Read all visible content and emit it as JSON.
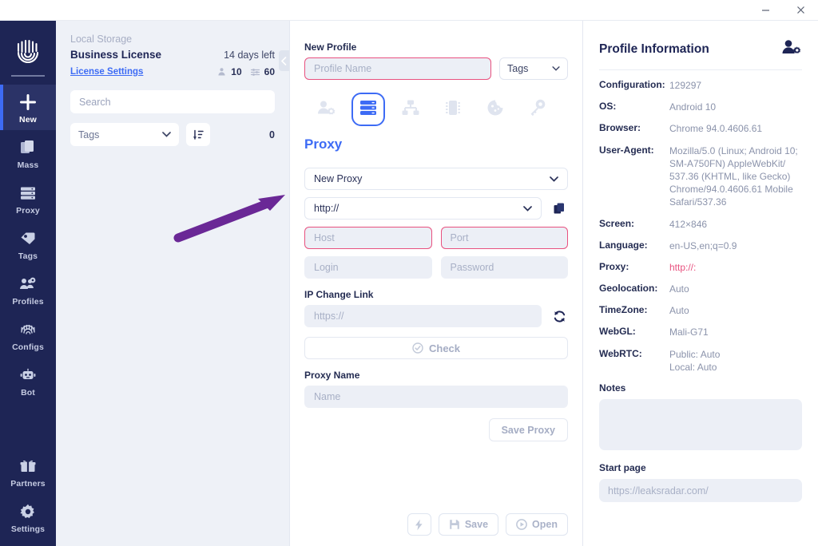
{
  "titlebar": {
    "minimize": "minimize-icon",
    "close": "close-icon"
  },
  "rail": {
    "logo": "fingerprint-logo",
    "items": [
      {
        "label": "New",
        "icon": "plus-icon",
        "active": true
      },
      {
        "label": "Mass",
        "icon": "copy-files-icon",
        "active": false
      },
      {
        "label": "Proxy",
        "icon": "server-icon",
        "active": false
      },
      {
        "label": "Tags",
        "icon": "tags-icon",
        "active": false
      },
      {
        "label": "Profiles",
        "icon": "people-gear-icon",
        "active": false
      },
      {
        "label": "Configs",
        "icon": "fingerprint-icon",
        "active": false
      },
      {
        "label": "Bot",
        "icon": "robot-icon",
        "active": false
      }
    ],
    "bottom_items": [
      {
        "label": "Partners",
        "icon": "gift-icon"
      },
      {
        "label": "Settings",
        "icon": "gear-icon"
      }
    ]
  },
  "storage": {
    "title": "Local Storage",
    "license_name": "Business License",
    "days_left": "14 days left",
    "license_settings_link": "License Settings",
    "profiles_count": "10",
    "proxies_count": "60",
    "search_placeholder": "Search",
    "tags_select": "Tags",
    "sort_icon": "sort-descending-icon",
    "total": "0",
    "collapse_icon": "chevron-left-icon"
  },
  "center": {
    "profile_label": "New Profile",
    "profile_name_placeholder": "Profile Name",
    "profile_name_value": "",
    "tags_select": "Tags",
    "tabs": [
      {
        "name": "person-gear-icon",
        "active": false
      },
      {
        "name": "server-icon",
        "active": true
      },
      {
        "name": "network-icon",
        "active": false
      },
      {
        "name": "chip-icon",
        "active": false
      },
      {
        "name": "cookie-icon",
        "active": false
      },
      {
        "name": "key-icon",
        "active": false
      }
    ],
    "section_title": "Proxy",
    "proxy_select": "New Proxy",
    "protocol_select": "http://",
    "copy_icon": "copy-icon",
    "host_placeholder": "Host",
    "port_placeholder": "Port",
    "login_placeholder": "Login",
    "password_placeholder": "Password",
    "ip_change_label": "IP Change Link",
    "ip_change_placeholder": "https://",
    "refresh_icon": "refresh-icon",
    "check_label": "Check",
    "check_icon": "check-circle-icon",
    "proxy_name_label": "Proxy Name",
    "proxy_name_placeholder": "Name",
    "save_proxy_label": "Save Proxy",
    "footer": {
      "quick_icon": "lightning-icon",
      "save_label": "Save",
      "save_icon": "floppy-icon",
      "open_label": "Open",
      "open_icon": "play-circle-icon"
    }
  },
  "info": {
    "title": "Profile Information",
    "header_icon": "person-gear-icon",
    "rows": [
      {
        "key": "Configuration:",
        "value": "129297",
        "red": false
      },
      {
        "key": "OS:",
        "value": "Android 10",
        "red": false
      },
      {
        "key": "Browser:",
        "value": "Chrome 94.0.4606.61",
        "red": false
      },
      {
        "key": "User-Agent:",
        "value": "Mozilla/5.0 (Linux; Android 10;\nSM-A750FN) AppleWebKit/\n537.36 (KHTML, like Gecko)\nChrome/94.0.4606.61 Mobile\nSafari/537.36",
        "red": false
      },
      {
        "key": "Screen:",
        "value": "412×846",
        "red": false
      },
      {
        "key": "Language:",
        "value": "en-US,en;q=0.9",
        "red": false
      },
      {
        "key": "Proxy:",
        "value": "http://:",
        "red": true
      },
      {
        "key": "Geolocation:",
        "value": "Auto",
        "red": false
      },
      {
        "key": "TimeZone:",
        "value": "Auto",
        "red": false
      },
      {
        "key": "WebGL:",
        "value": "Mali-G71",
        "red": false
      },
      {
        "key": "WebRTC:",
        "value": "Public: Auto\nLocal:  Auto",
        "red": false
      }
    ],
    "notes_label": "Notes",
    "notes_value": "",
    "start_page_label": "Start page",
    "start_page_placeholder": "https://leaksradar.com/",
    "start_page_value": ""
  },
  "annotation": {
    "arrow_color": "#6a2896",
    "arrow": "purple-arrow-pointing-to-protocol-dropdown"
  },
  "colors": {
    "rail_bg": "#1e2555",
    "accent_blue": "#3d6bf5",
    "error_pink": "#e8517f",
    "panel_bg": "#eef1f7"
  }
}
